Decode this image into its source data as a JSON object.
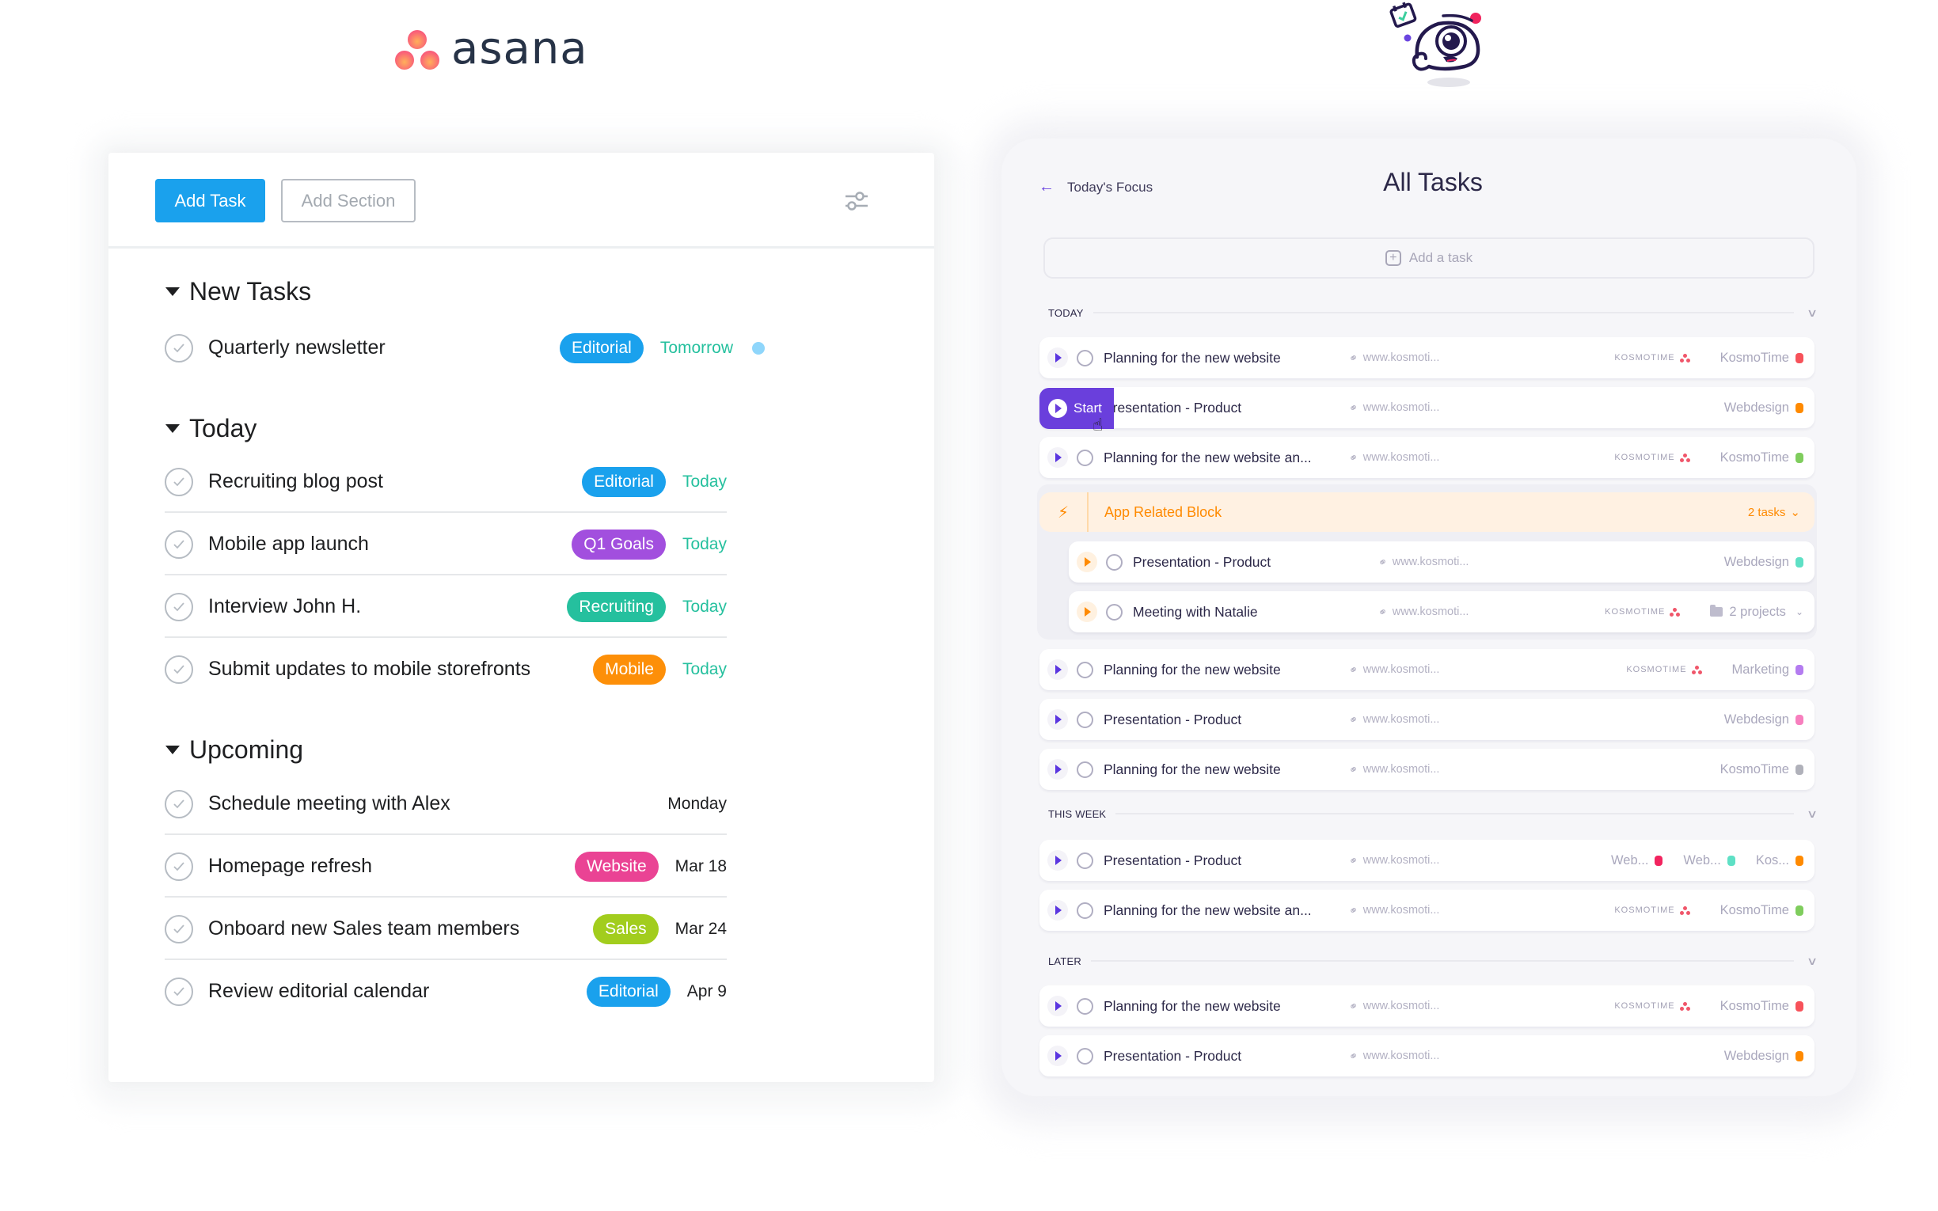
{
  "logos": {
    "left_brand": "asana",
    "right_brand_icon": "kosmotime-mascot-icon"
  },
  "asana": {
    "toolbar": {
      "add_task_label": "Add Task",
      "add_section_label": "Add Section",
      "filter_icon": "sliders-icon"
    },
    "sections": [
      {
        "title": "New Tasks",
        "tasks": [
          {
            "name": "Quarterly newsletter",
            "tag": "Editorial",
            "tag_color": "#1aa1ed",
            "due": "Tomorrow",
            "due_style": "green",
            "dot_color": "#8fd6fb"
          }
        ]
      },
      {
        "title": "Today",
        "tasks": [
          {
            "name": "Recruiting blog post",
            "tag": "Editorial",
            "tag_color": "#1aa1ed",
            "due": "Today",
            "due_style": "green"
          },
          {
            "name": "Mobile app launch",
            "tag": "Q1 Goals",
            "tag_color": "#a24fde",
            "due": "Today",
            "due_style": "green"
          },
          {
            "name": "Interview John H.",
            "tag": "Recruiting",
            "tag_color": "#25c09e",
            "due": "Today",
            "due_style": "green"
          },
          {
            "name": "Submit updates to mobile storefronts",
            "tag": "Mobile",
            "tag_color": "#fd8f08",
            "due": "Today",
            "due_style": "green"
          }
        ]
      },
      {
        "title": "Upcoming",
        "tasks": [
          {
            "name": "Schedule meeting with Alex",
            "tag": null,
            "due": "Monday",
            "due_style": "dark"
          },
          {
            "name": "Homepage refresh",
            "tag": "Website",
            "tag_color": "#ea4394",
            "due": "Mar 18",
            "due_style": "dark"
          },
          {
            "name": "Onboard new Sales team members",
            "tag": "Sales",
            "tag_color": "#a2cd1d",
            "due": "Mar 24",
            "due_style": "dark"
          },
          {
            "name": "Review editorial calendar",
            "tag": "Editorial",
            "tag_color": "#1aa1ed",
            "due": "Apr 9",
            "due_style": "dark"
          }
        ]
      }
    ]
  },
  "kosmotime": {
    "back_label": "Today's Focus",
    "title": "All Tasks",
    "add_task_placeholder": "Add a task",
    "start_label": "Start",
    "groups": {
      "today": "TODAY",
      "this_week": "THIS WEEK",
      "later": "LATER"
    },
    "app_block": {
      "title": "App Related Block",
      "count": "2 tasks"
    },
    "kosmotime_badge": "KOSMOTIME",
    "link_text": "www.kosmoti...",
    "rows": [
      {
        "name": "Planning for the new website",
        "badge": true,
        "project": "KosmoTime",
        "color": "#f7525a"
      },
      {
        "name": "Presentation - Product",
        "badge": false,
        "project": "Webdesign",
        "color": "#ff8a00",
        "hover_start": true
      },
      {
        "name": "Planning for the new website an...",
        "badge": true,
        "project": "KosmoTime",
        "color": "#7fcd5d"
      },
      {
        "name": "Presentation - Product",
        "badge": false,
        "project": "Webdesign",
        "color": "#5ee0c5"
      },
      {
        "name": "Meeting with Natalie",
        "badge": true,
        "project": "2 projects",
        "color": null
      },
      {
        "name": "Planning for the new website",
        "badge": true,
        "project": "Marketing",
        "color": "#b47cf0"
      },
      {
        "name": "Presentation - Product",
        "badge": false,
        "project": "Webdesign",
        "color": "#f77fbe"
      },
      {
        "name": "Planning for the new website",
        "badge": false,
        "project": "KosmoTime",
        "color": "#b0b1ba"
      },
      {
        "name": "Presentation - Product",
        "badge": false,
        "projects": [
          {
            "project": "Web...",
            "color": "#f2245f"
          },
          {
            "project": "Web...",
            "color": "#5ee0c5"
          },
          {
            "project": "Kos...",
            "color": "#ff8a00"
          }
        ]
      },
      {
        "name": "Planning for the new website an...",
        "badge": true,
        "project": "KosmoTime",
        "color": "#7fcd5d"
      },
      {
        "name": "Planning for the new website",
        "badge": true,
        "project": "KosmoTime",
        "color": "#f7525a"
      },
      {
        "name": "Presentation - Product",
        "badge": false,
        "project": "Webdesign",
        "color": "#ff8a00"
      }
    ]
  }
}
